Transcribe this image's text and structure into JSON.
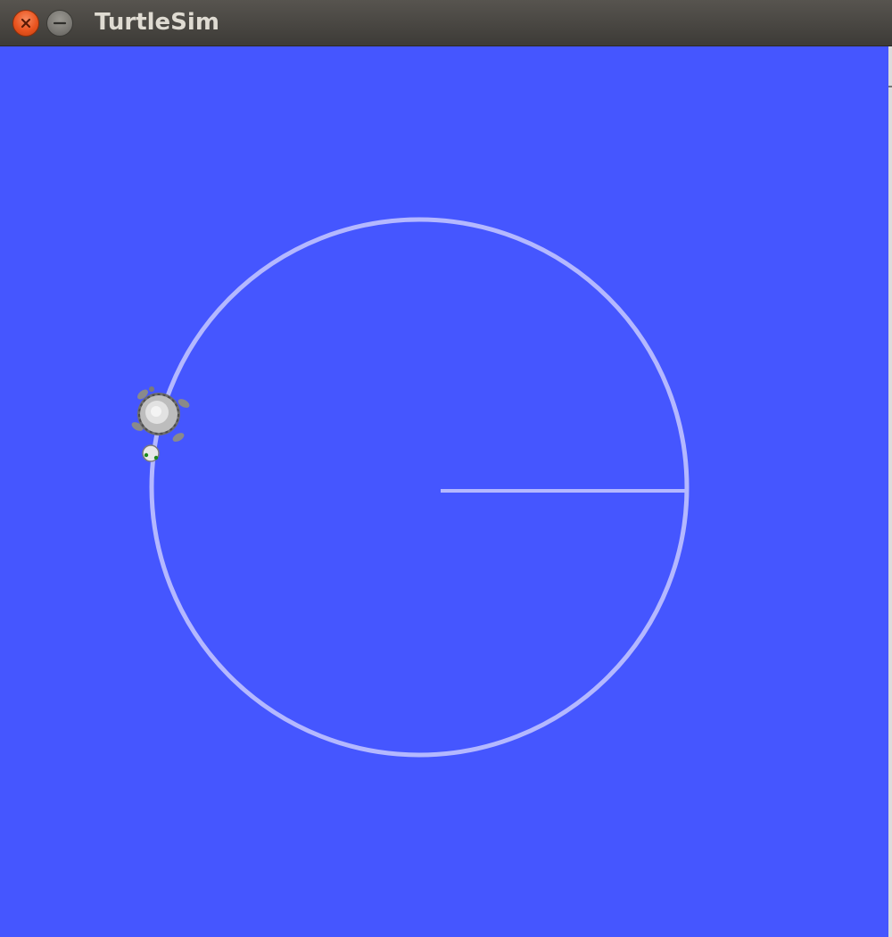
{
  "window": {
    "title": "TurtleSim",
    "controls": {
      "close_icon": "close-icon",
      "minimize_icon": "minimize-icon"
    }
  },
  "canvas": {
    "background_color": "#4556ff",
    "pen_color": "#b4b8ff",
    "turtle_icon": "turtle-icon"
  }
}
